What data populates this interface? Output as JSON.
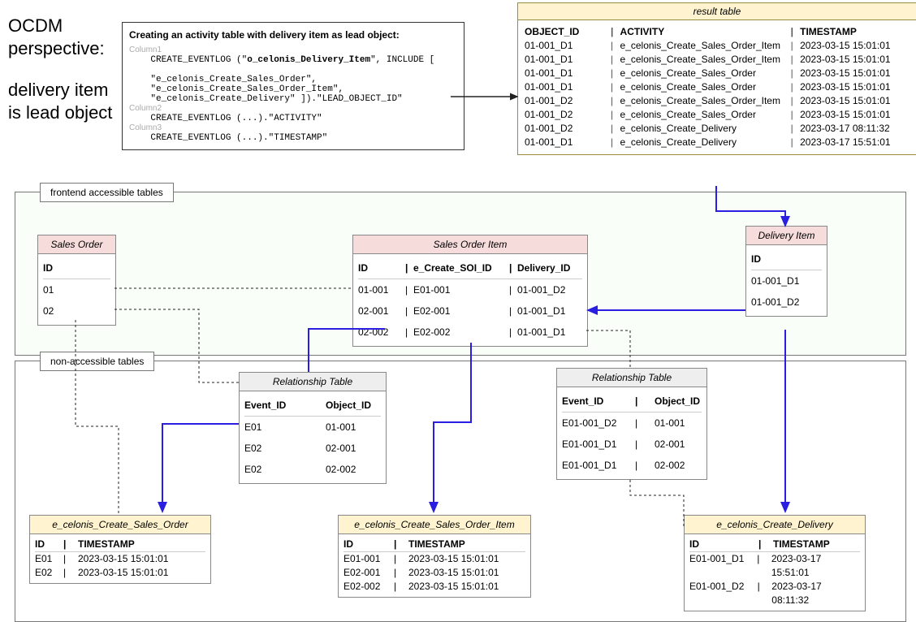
{
  "title_line1": "OCDM perspective:",
  "title_line2": "delivery item is lead object",
  "codebox": {
    "header": "Creating an activity table with delivery item as lead object:",
    "col1": "Column1",
    "code1a": "    CREATE_EVENTLOG (\"",
    "code1b": "o_celonis_Delivery_Item",
    "code1c": "\", INCLUDE [",
    "code1d": "    \"e_celonis_Create_Sales_Order\",",
    "code1e": "    \"e_celonis_Create_Sales_Order_Item\",",
    "code1f": "    \"e_celonis_Create_Delivery\" ]).\"LEAD_OBJECT_ID\"",
    "col2": "Column2",
    "code2": "    CREATE_EVENTLOG (...).\"ACTIVITY\"",
    "col3": "Column3",
    "code3": "    CREATE_EVENTLOG (...).\"TIMESTAMP\""
  },
  "result": {
    "title": "result table",
    "headers": [
      "OBJECT_ID",
      "ACTIVITY",
      "TIMESTAMP"
    ],
    "rows": [
      [
        "01-001_D1",
        "e_celonis_Create_Sales_Order_Item",
        "2023-03-15 15:01:01"
      ],
      [
        "01-001_D1",
        "e_celonis_Create_Sales_Order_Item",
        "2023-03-15 15:01:01"
      ],
      [
        "01-001_D1",
        "e_celonis_Create_Sales_Order",
        "2023-03-15 15:01:01"
      ],
      [
        "01-001_D1",
        "e_celonis_Create_Sales_Order",
        "2023-03-15 15:01:01"
      ],
      [
        "01-001_D2",
        "e_celonis_Create_Sales_Order_Item",
        "2023-03-15 15:01:01"
      ],
      [
        "01-001_D2",
        "e_celonis_Create_Sales_Order",
        "2023-03-15 15:01:01"
      ],
      [
        "01-001_D2",
        "e_celonis_Create_Delivery",
        "2023-03-17 08:11:32"
      ],
      [
        "01-001_D1",
        "e_celonis_Create_Delivery",
        "2023-03-17 15:51:01"
      ]
    ]
  },
  "region_accessible": "frontend accessible tables",
  "region_nonaccess": "non-accessible tables",
  "sales_order": {
    "title": "Sales Order",
    "header": "ID",
    "rows": [
      "01",
      "02"
    ]
  },
  "soi": {
    "title": "Sales Order Item",
    "h1": "ID",
    "h2": "e_Create_SOI_ID",
    "h3": "Delivery_ID",
    "rows": [
      [
        "01-001",
        "E01-001",
        "01-001_D2"
      ],
      [
        "02-001",
        "E02-001",
        "01-001_D1"
      ],
      [
        "02-002",
        "E02-002",
        "01-001_D1"
      ]
    ]
  },
  "delivery_item": {
    "title": "Delivery Item",
    "header": "ID",
    "rows": [
      "01-001_D1",
      "01-001_D2"
    ]
  },
  "rel1": {
    "title": "Relationship Table",
    "h1": "Event_ID",
    "h2": "Object_ID",
    "rows": [
      [
        "E01",
        "01-001"
      ],
      [
        "E02",
        "02-001"
      ],
      [
        "E02",
        "02-002"
      ]
    ]
  },
  "rel2": {
    "title": "Relationship Table",
    "h1": "Event_ID",
    "h2": "Object_ID",
    "rows": [
      [
        "E01-001_D2",
        "01-001"
      ],
      [
        "E01-001_D1",
        "02-001"
      ],
      [
        "E01-001_D1",
        "02-002"
      ]
    ]
  },
  "ev_so": {
    "title": "e_celonis_Create_Sales_Order",
    "h1": "ID",
    "h2": "TIMESTAMP",
    "rows": [
      [
        "E01",
        "2023-03-15 15:01:01"
      ],
      [
        "E02",
        "2023-03-15 15:01:01"
      ]
    ]
  },
  "ev_soi": {
    "title": "e_celonis_Create_Sales_Order_Item",
    "h1": "ID",
    "h2": "TIMESTAMP",
    "rows": [
      [
        "E01-001",
        "2023-03-15 15:01:01"
      ],
      [
        "E02-001",
        "2023-03-15 15:01:01"
      ],
      [
        "E02-002",
        "2023-03-15 15:01:01"
      ]
    ]
  },
  "ev_del": {
    "title": "e_celonis_Create_Delivery",
    "h1": "ID",
    "h2": "TIMESTAMP",
    "rows": [
      [
        "E01-001_D1",
        "2023-03-17 15:51:01"
      ],
      [
        "E01-001_D2",
        "2023-03-17 08:11:32"
      ]
    ]
  }
}
